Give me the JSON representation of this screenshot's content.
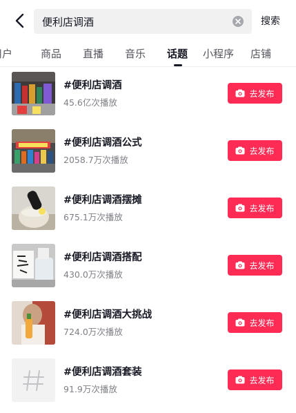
{
  "header": {
    "back_icon": "chevron-left-icon",
    "search_value": "便利店调酒",
    "clear_icon": "clear-circle-icon",
    "search_button_label": "搜索"
  },
  "tabs": [
    {
      "label": "用户"
    },
    {
      "label": "商品"
    },
    {
      "label": "直播"
    },
    {
      "label": "音乐"
    },
    {
      "label": "话题"
    },
    {
      "label": "小程序"
    },
    {
      "label": "店铺"
    }
  ],
  "active_tab": "话题",
  "results": [
    {
      "title": "#便利店调酒",
      "plays": "45.6亿次播放",
      "button_label": "去发布",
      "button_icon": "camera-icon"
    },
    {
      "title": "#便利店调酒公式",
      "plays": "2058.7万次播放",
      "button_label": "去发布",
      "button_icon": "camera-icon"
    },
    {
      "title": "#便利店调酒摆摊",
      "plays": "675.1万次播放",
      "button_label": "去发布",
      "button_icon": "camera-icon"
    },
    {
      "title": "#便利店调酒搭配",
      "plays": "430.0万次播放",
      "button_label": "去发布",
      "button_icon": "camera-icon"
    },
    {
      "title": "#便利店调酒大挑战",
      "plays": "724.0万次播放",
      "button_label": "去发布",
      "button_icon": "camera-icon"
    },
    {
      "title": "#便利店调酒套装",
      "plays": "91.9万次播放",
      "button_label": "去发布",
      "button_icon": "camera-icon"
    }
  ],
  "colors": {
    "accent": "#fe2c55",
    "text_primary": "#161823",
    "text_secondary": "#7f8087",
    "search_bg": "#f1f1f2"
  }
}
